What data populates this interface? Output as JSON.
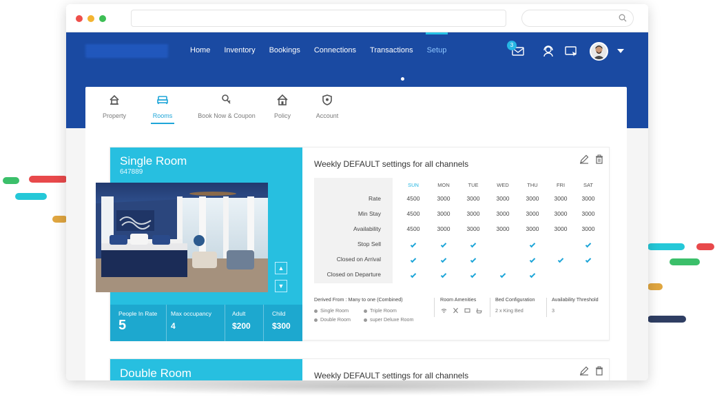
{
  "nav": {
    "items": [
      {
        "label": "Home"
      },
      {
        "label": "Inventory"
      },
      {
        "label": "Bookings"
      },
      {
        "label": "Connections"
      },
      {
        "label": "Transactions"
      },
      {
        "label": "Setup",
        "active": true
      }
    ],
    "mail_badge": "3"
  },
  "tabs": [
    {
      "label": "Property",
      "icon": "property-icon"
    },
    {
      "label": "Rooms",
      "icon": "bed-icon",
      "active": true
    },
    {
      "label": "Book Now & Coupon",
      "icon": "key-icon"
    },
    {
      "label": "Policy",
      "icon": "house-icon"
    },
    {
      "label": "Account",
      "icon": "shield-icon"
    }
  ],
  "room1": {
    "title": "Single Room",
    "code": "647889",
    "stats": [
      {
        "label": "People In Rate",
        "value": "5"
      },
      {
        "label": "Max occupancy",
        "value": "4"
      },
      {
        "label": "Adult",
        "value": "$200"
      },
      {
        "label": "Child",
        "value": "$300"
      }
    ],
    "weekly_title": "Weekly DEFAULT settings for all channels",
    "days": [
      "SUN",
      "MON",
      "TUE",
      "WED",
      "THU",
      "FRI",
      "SAT"
    ],
    "rows": [
      {
        "label": "Rate",
        "values": [
          "4500",
          "3000",
          "3000",
          "3000",
          "3000",
          "3000",
          "3000"
        ]
      },
      {
        "label": "Min Stay",
        "values": [
          "4500",
          "3000",
          "3000",
          "3000",
          "3000",
          "3000",
          "3000"
        ]
      },
      {
        "label": "Availability",
        "values": [
          "4500",
          "3000",
          "3000",
          "3000",
          "3000",
          "3000",
          "3000"
        ]
      },
      {
        "label": "Stop Sell",
        "checks": [
          true,
          true,
          true,
          false,
          true,
          false,
          true
        ]
      },
      {
        "label": "Closed on Arrival",
        "checks": [
          true,
          true,
          true,
          false,
          true,
          true,
          true
        ]
      },
      {
        "label": "Closed on Departure",
        "checks": [
          true,
          true,
          true,
          true,
          true,
          false,
          false
        ]
      }
    ],
    "derived": {
      "label": "Derived From :",
      "value": "Many to one (Combined)",
      "items": [
        "Single Room",
        "Double Room",
        "Triple Room",
        "super Deluxe Room"
      ]
    },
    "amenities_label": "Room Amenities",
    "bed_config": {
      "label": "Bed Configuration",
      "value": "2 x King Bed"
    },
    "availability_threshold": {
      "label": "Availability Threshold",
      "value": "3"
    }
  },
  "room2": {
    "title": "Double Room",
    "weekly_title": "Weekly DEFAULT settings for all channels"
  },
  "colors": {
    "nav_blue": "#1a4aa2",
    "room_cyan": "#27bfe0",
    "accent": "#1ea5d8"
  }
}
